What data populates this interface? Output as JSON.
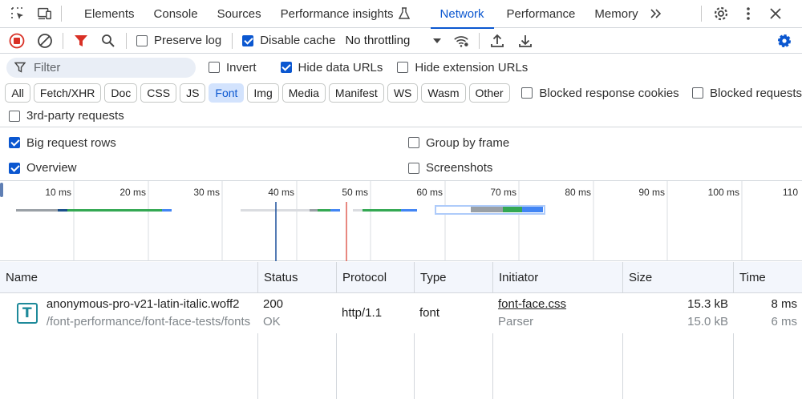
{
  "tabs": [
    {
      "label": "Elements",
      "active": false
    },
    {
      "label": "Console",
      "active": false
    },
    {
      "label": "Sources",
      "active": false
    },
    {
      "label": "Performance insights",
      "active": false
    },
    {
      "label": "Network",
      "active": true
    },
    {
      "label": "Performance",
      "active": false
    },
    {
      "label": "Memory",
      "active": false
    }
  ],
  "toolbar": {
    "preserve_log": "Preserve log",
    "preserve_log_checked": false,
    "disable_cache": "Disable cache",
    "disable_cache_checked": true,
    "throttling": "No throttling"
  },
  "filter": {
    "placeholder": "Filter",
    "invert": "Invert",
    "invert_checked": false,
    "hide_data_urls": "Hide data URLs",
    "hide_data_urls_checked": true,
    "hide_extension_urls": "Hide extension URLs",
    "hide_extension_urls_checked": false
  },
  "type_filters": [
    {
      "label": "All",
      "active": false
    },
    {
      "label": "Fetch/XHR",
      "active": false
    },
    {
      "label": "Doc",
      "active": false
    },
    {
      "label": "CSS",
      "active": false
    },
    {
      "label": "JS",
      "active": false
    },
    {
      "label": "Font",
      "active": true
    },
    {
      "label": "Img",
      "active": false
    },
    {
      "label": "Media",
      "active": false
    },
    {
      "label": "Manifest",
      "active": false
    },
    {
      "label": "WS",
      "active": false
    },
    {
      "label": "Wasm",
      "active": false
    },
    {
      "label": "Other",
      "active": false
    }
  ],
  "blocked_cookies": "Blocked response cookies",
  "blocked_requests": "Blocked requests",
  "third_party": "3rd-party requests",
  "settings": {
    "big_rows": "Big request rows",
    "big_rows_checked": true,
    "group_by_frame": "Group by frame",
    "group_by_frame_checked": false,
    "overview": "Overview",
    "overview_checked": true,
    "screenshots": "Screenshots",
    "screenshots_checked": false
  },
  "timeline": {
    "ticks": [
      "10 ms",
      "20 ms",
      "30 ms",
      "40 ms",
      "50 ms",
      "60 ms",
      "70 ms",
      "80 ms",
      "90 ms",
      "100 ms",
      "110"
    ]
  },
  "columns": [
    "Name",
    "Status",
    "Protocol",
    "Type",
    "Initiator",
    "Size",
    "Time"
  ],
  "rows": [
    {
      "name": "anonymous-pro-v21-latin-italic.woff2",
      "path": "/font-performance/font-face-tests/fonts",
      "status": "200",
      "status_text": "OK",
      "protocol": "http/1.1",
      "type": "font",
      "initiator": "font-face.css",
      "initiator_type": "Parser",
      "size": "15.3 kB",
      "resource_size": "15.0 kB",
      "time": "8 ms",
      "latency": "6 ms",
      "icon_letter": "T"
    }
  ],
  "colors": {
    "accent": "#0b57d0",
    "record_red": "#d93025",
    "font_icon": "#1e8a9a"
  }
}
